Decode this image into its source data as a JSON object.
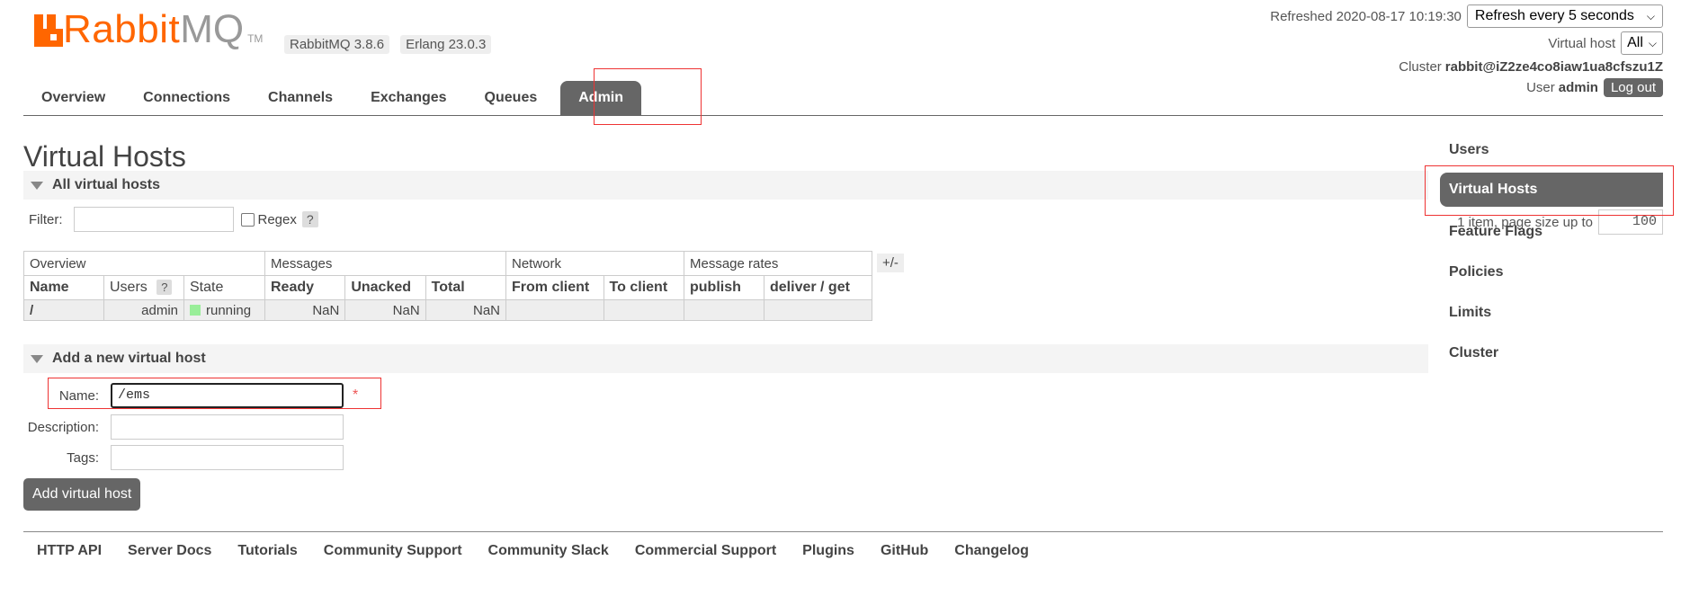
{
  "header": {
    "logo_text_rabbit": "Rabbit",
    "logo_text_mq": "MQ",
    "logo_tm": "TM",
    "rabbitmq_version": "RabbitMQ 3.8.6",
    "erlang_version": "Erlang 23.0.3",
    "refreshed_label": "Refreshed 2020-08-17 10:19:30",
    "refresh_select": "Refresh every 5 seconds",
    "virtual_host_label": "Virtual host",
    "virtual_host_select": "All",
    "cluster_label": "Cluster",
    "cluster_name": "rabbit@iZ2ze4co8iaw1ua8cfszu1Z",
    "user_label": "User",
    "user_name": "admin",
    "logout_label": "Log out"
  },
  "nav": {
    "tabs": [
      "Overview",
      "Connections",
      "Channels",
      "Exchanges",
      "Queues",
      "Admin"
    ],
    "active": "Admin"
  },
  "page": {
    "title": "Virtual Hosts",
    "all_section": "All virtual hosts",
    "filter_label": "Filter:",
    "regex_label": "Regex",
    "help_mark": "?",
    "pager_text": "1 item, page size up to",
    "page_size": "100",
    "plus_minus": "+/-"
  },
  "table": {
    "groups": [
      "Overview",
      "Messages",
      "Network",
      "Message rates"
    ],
    "columns": [
      "Name",
      "Users",
      "State",
      "Ready",
      "Unacked",
      "Total",
      "From client",
      "To client",
      "publish",
      "deliver / get"
    ],
    "users_help": "?",
    "rows": [
      {
        "name": "/",
        "users": "admin",
        "state": "running",
        "ready": "NaN",
        "unacked": "NaN",
        "total": "NaN",
        "from_client": "",
        "to_client": "",
        "publish": "",
        "deliver_get": ""
      }
    ]
  },
  "add_form": {
    "section": "Add a new virtual host",
    "name_label": "Name:",
    "name_value": "/ems",
    "required_mark": "*",
    "description_label": "Description:",
    "tags_label": "Tags:",
    "submit_label": "Add virtual host"
  },
  "footer": {
    "links": [
      "HTTP API",
      "Server Docs",
      "Tutorials",
      "Community Support",
      "Community Slack",
      "Commercial Support",
      "Plugins",
      "GitHub",
      "Changelog"
    ]
  },
  "sidebar": {
    "items": [
      "Users",
      "Virtual Hosts",
      "Feature Flags",
      "Policies",
      "Limits",
      "Cluster"
    ],
    "active": "Virtual Hosts"
  },
  "colors": {
    "brand_orange": "#ff6600",
    "active_tab": "#666666",
    "highlight_red": "#ee3333",
    "running_green": "#99ee99"
  }
}
